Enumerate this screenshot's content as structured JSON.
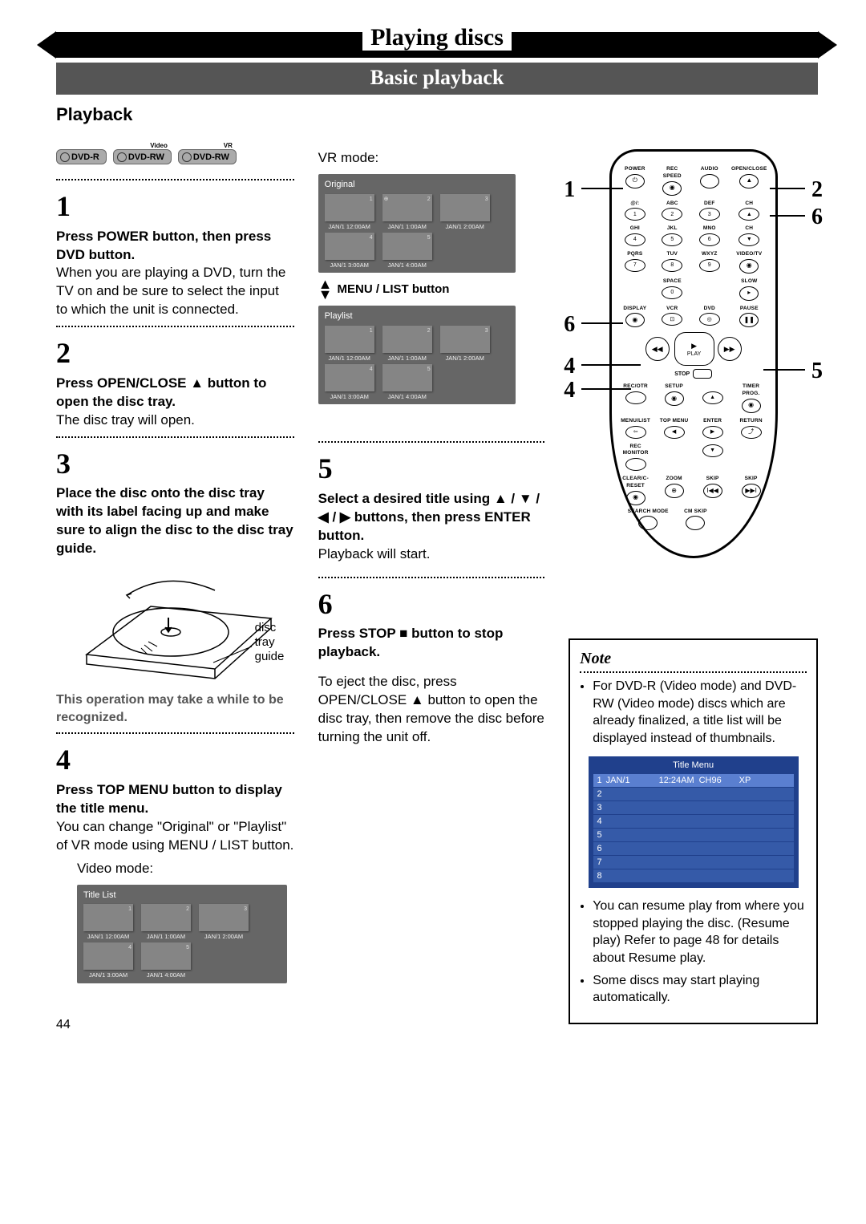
{
  "header": {
    "main_title": "Playing discs",
    "subtitle": "Basic playback"
  },
  "left": {
    "heading": "Playback",
    "badges": [
      {
        "text": "DVD-R",
        "sup": ""
      },
      {
        "text": "DVD-RW",
        "sup": "Video"
      },
      {
        "text": "DVD-RW",
        "sup": "VR"
      }
    ],
    "step1": {
      "num": "1",
      "bold": "Press POWER button, then press DVD button.",
      "body": "When you are playing a DVD, turn the TV on and be sure to select the input to which the unit is connected."
    },
    "step2": {
      "num": "2",
      "bold": "Press OPEN/CLOSE ▲ button to open the disc tray.",
      "body": "The disc tray will open."
    },
    "step3": {
      "num": "3",
      "bold": "Place the disc onto the disc tray with its label facing up and make sure to align the disc to the disc tray guide.",
      "body": ""
    },
    "tray_label1": "disc",
    "tray_label2": "tray",
    "tray_label3": "guide",
    "hint": "This operation may take a while to be recognized.",
    "step4": {
      "num": "4",
      "bold": "Press TOP MENU button to display the title menu.",
      "body": "You can change \"Original\" or \"Playlist\" of VR mode using MENU / LIST button."
    },
    "video_mode_label": "Video mode:",
    "grid_title": "Title List",
    "thumbs_row1": [
      {
        "n": "1",
        "cap": "JAN/1   12:00AM"
      },
      {
        "n": "2",
        "cap": "JAN/1   1:00AM"
      },
      {
        "n": "3",
        "cap": "JAN/1   2:00AM"
      }
    ],
    "thumbs_row2": [
      {
        "n": "4",
        "cap": "JAN/1   3:00AM"
      },
      {
        "n": "5",
        "cap": "JAN/1   4:00AM"
      }
    ]
  },
  "mid": {
    "vr_mode_label": "VR mode:",
    "grid1_title": "Original",
    "grid1_row1": [
      {
        "n": "1",
        "cap": "JAN/1   12:00AM"
      },
      {
        "n": "2",
        "cap": "JAN/1   1:00AM"
      },
      {
        "n": "3",
        "cap": "JAN/1   2:00AM"
      }
    ],
    "grid1_row2": [
      {
        "n": "4",
        "cap": "JAN/1   3:00AM"
      },
      {
        "n": "5",
        "cap": "JAN/1   4:00AM"
      }
    ],
    "menu_list_label": "MENU / LIST button",
    "grid2_title": "Playlist",
    "grid2_row1": [
      {
        "n": "1",
        "cap": "JAN/1   12:00AM"
      },
      {
        "n": "2",
        "cap": "JAN/1   1:00AM"
      },
      {
        "n": "3",
        "cap": "JAN/1   2:00AM"
      }
    ],
    "grid2_row2": [
      {
        "n": "4",
        "cap": "JAN/1   3:00AM"
      },
      {
        "n": "5",
        "cap": "JAN/1   4:00AM"
      }
    ],
    "step5": {
      "num": "5",
      "bold": "Select a desired title using ▲ / ▼ / ◀ / ▶ buttons, then press ENTER button.",
      "body": "Playback will start."
    },
    "step6": {
      "num": "6",
      "bold": "Press STOP ■ button to stop playback.",
      "body": "To eject the disc, press OPEN/CLOSE ▲ button to open the disc tray, then remove the disc before turning the unit off."
    }
  },
  "remote": {
    "callouts": {
      "l1": "1",
      "l2": "6",
      "l3": "4",
      "l4": "4",
      "r1": "2",
      "r2": "6",
      "r3": "5"
    },
    "labels": {
      "POWER": "POWER",
      "REC_SPEED": "REC SPEED",
      "AUDIO": "AUDIO",
      "OPEN_CLOSE": "OPEN/CLOSE",
      "r1a": "@/:",
      "r1b": "ABC",
      "r1c": "DEF",
      "r1d": "",
      "n1": "1",
      "n2": "2",
      "n3": "3",
      "r2a": "GHI",
      "r2b": "JKL",
      "r2c": "MNO",
      "r2d": "CH",
      "n4": "4",
      "n5": "5",
      "n6": "6",
      "chd": "▼",
      "r3a": "PQRS",
      "r3b": "TUV",
      "r3c": "WXYZ",
      "r3d": "VIDEO/TV",
      "n7": "7",
      "n8": "8",
      "n9": "9",
      "r4a": "",
      "r4b": "SPACE",
      "r4c": "",
      "r4d": "SLOW",
      "n0": "0",
      "r5a": "DISPLAY",
      "r5b": "VCR",
      "r5c": "DVD",
      "r5d": "PAUSE",
      "PLAY": "PLAY",
      "STOP": "STOP",
      "r6a": "REC/OTR",
      "r6b": "SETUP",
      "r6c": "",
      "r6d": "TIMER PROG.",
      "r7a": "MENU/LIST",
      "r7b": "TOP MENU",
      "r7c": "ENTER",
      "r7d": "RETURN",
      "r8a": "REC MONITOR",
      "r8b": "",
      "r8c": "",
      "r8d": "",
      "r9a": "CLEAR/C-RESET",
      "r9b": "ZOOM",
      "r9c": "SKIP",
      "r9d": "SKIP",
      "r10a": "SEARCH MODE",
      "r10b": "CM SKIP"
    }
  },
  "note": {
    "title": "Note",
    "item1": "For DVD-R (Video mode) and DVD-RW (Video mode) discs which are already finalized, a title list will be displayed instead of thumbnails.",
    "tm_head": "Title Menu",
    "tm_row": {
      "n": "1",
      "d": "JAN/1",
      "t": "12:24AM",
      "c": "CH96",
      "m": "XP"
    },
    "item2": "You can resume play from where you stopped playing the disc. (Resume play) Refer to page 48 for details about Resume play.",
    "item3": "Some discs may start playing automatically."
  },
  "page_number": "44"
}
